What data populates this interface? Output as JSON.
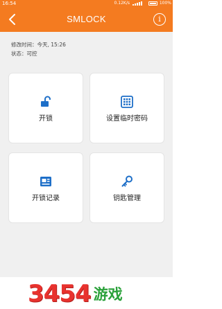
{
  "status_bar": {
    "time": "16:54",
    "network_speed": "0.12K/s",
    "battery": "100%"
  },
  "app_bar": {
    "title": "SMLOCK",
    "back_icon": "chevron-left-icon",
    "info_icon": "info-circle-icon"
  },
  "lock_info": {
    "modified_line": "修改时间：今天, 15:26",
    "status_line": "状态：可控"
  },
  "actions": [
    {
      "label": "开锁",
      "icon": "unlock-icon"
    },
    {
      "label": "设置临时密码",
      "icon": "keypad-icon"
    },
    {
      "label": "开锁记录",
      "icon": "record-icon"
    },
    {
      "label": "钥匙管理",
      "icon": "key-icon"
    }
  ],
  "watermark": {
    "number": "3454",
    "text": "游戏"
  },
  "colors": {
    "accent": "#f47b20",
    "icon_blue": "#1e6fc8",
    "background": "#f0f0f0",
    "watermark_red": "#e8322e",
    "watermark_green": "#2aa13a"
  }
}
